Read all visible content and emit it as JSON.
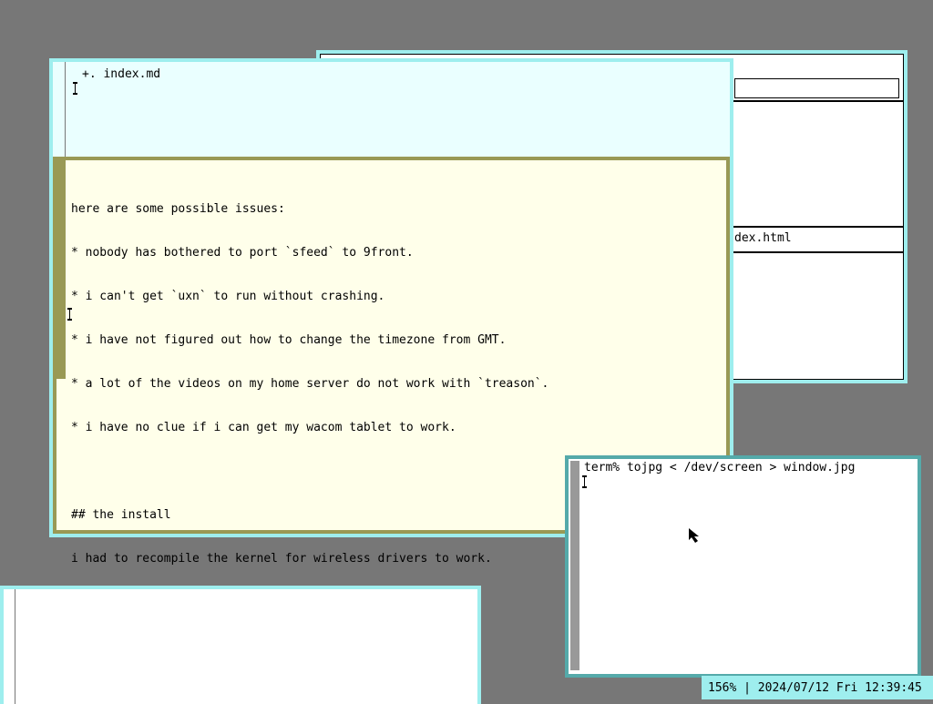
{
  "back_window": {
    "filename_fragment": "dex.html"
  },
  "editor": {
    "tag_text": "+. index.md",
    "body_lines": [
      "here are some possible issues:",
      "* nobody has bothered to port `sfeed` to 9front.",
      "* i can't get `uxn` to run without crashing.",
      "* i have not figured out how to change the timezone from GMT.",
      "* a lot of the videos on my home server do not work with `treason`.",
      "* i have no clue if i can get my wacom tablet to work.",
      "",
      "## the install",
      "i had to recompile the kernel for wireless drivers to work."
    ]
  },
  "terminal": {
    "command_line": "term% tojpg < /dev/screen > window.jpg"
  },
  "statusbar": {
    "text": "156% | 2024/07/12 Fri 12:39:45"
  },
  "colors": {
    "desktop": "#777777",
    "window_border": "#9eeeee",
    "tag_bg": "#eaffff",
    "body_bg": "#ffffea",
    "body_frame": "#999955",
    "term_border": "#55aaaa"
  }
}
